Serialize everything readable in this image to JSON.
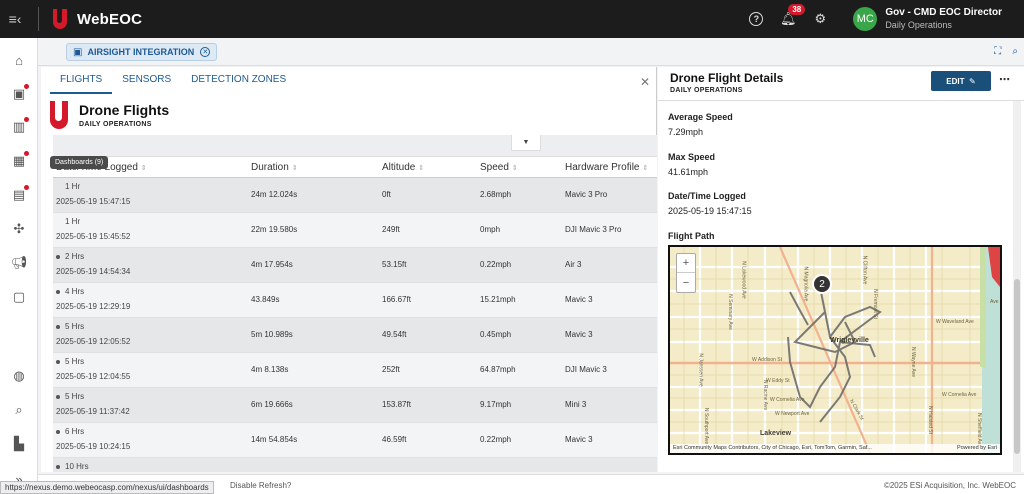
{
  "app": {
    "title": "WebEOC",
    "notifications_count": "38",
    "avatar_initials": "MC",
    "user_name": "Gov - CMD EOC Director",
    "user_sub": "Daily Operations",
    "brand_color": "#d4192b",
    "accent_color": "#1d5a95"
  },
  "nav": {
    "tooltip": "Dashboards (9)",
    "icons": [
      "home-icon",
      "layout-icon",
      "map-icon",
      "dashboards-icon",
      "chat-icon",
      "puzzle-icon",
      "megaphone-icon",
      "contact-icon",
      "globe-icon",
      "search-chart-icon",
      "building-icon",
      "expand-icon"
    ]
  },
  "doc_tab": {
    "label": "AIRSIGHT INTEGRATION"
  },
  "main": {
    "tabs": [
      "FLIGHTS",
      "SENSORS",
      "DETECTION ZONES"
    ],
    "board_title": "Drone Flights",
    "board_sub": "DAILY OPERATIONS",
    "columns": [
      "Date/Time Logged",
      "Duration",
      "Altitude",
      "Speed",
      "Hardware Profile"
    ],
    "rows": [
      {
        "age": "1 Hr",
        "dot": false,
        "date": "2025-05-19 15:47:15",
        "duration": "24m 12.024s",
        "altitude": "0ft",
        "speed": "2.68mph",
        "hardware": "Mavic 3 Pro"
      },
      {
        "age": "1 Hr",
        "dot": false,
        "date": "2025-05-19 15:45:52",
        "duration": "22m 19.580s",
        "altitude": "249ft",
        "speed": "0mph",
        "hardware": "DJI Mavic 3 Pro"
      },
      {
        "age": "2 Hrs",
        "dot": true,
        "date": "2025-05-19 14:54:34",
        "duration": "4m 17.954s",
        "altitude": "53.15ft",
        "speed": "0.22mph",
        "hardware": "Air 3"
      },
      {
        "age": "4 Hrs",
        "dot": true,
        "date": "2025-05-19 12:29:19",
        "duration": "43.849s",
        "altitude": "166.67ft",
        "speed": "15.21mph",
        "hardware": "Mavic 3"
      },
      {
        "age": "5 Hrs",
        "dot": true,
        "date": "2025-05-19 12:05:52",
        "duration": "5m 10.989s",
        "altitude": "49.54ft",
        "speed": "0.45mph",
        "hardware": "Mavic 3"
      },
      {
        "age": "5 Hrs",
        "dot": true,
        "date": "2025-05-19 12:04:55",
        "duration": "4m 8.138s",
        "altitude": "252ft",
        "speed": "64.87mph",
        "hardware": "DJI Mavic 3"
      },
      {
        "age": "5 Hrs",
        "dot": true,
        "date": "2025-05-19 11:37:42",
        "duration": "6m 19.666s",
        "altitude": "153.87ft",
        "speed": "9.17mph",
        "hardware": "Mini 3"
      },
      {
        "age": "6 Hrs",
        "dot": true,
        "date": "2025-05-19 10:24:15",
        "duration": "14m 54.854s",
        "altitude": "46.59ft",
        "speed": "0.22mph",
        "hardware": "Mavic 3"
      },
      {
        "age": "10 Hrs",
        "dot": true,
        "date": "",
        "duration": "",
        "altitude": "",
        "speed": "",
        "hardware": ""
      }
    ]
  },
  "detail": {
    "title": "Drone Flight Details",
    "sub": "DAILY OPERATIONS",
    "edit_label": "EDIT",
    "fields": [
      {
        "label": "Average Speed",
        "value": "7.29mph"
      },
      {
        "label": "Max Speed",
        "value": "41.61mph"
      },
      {
        "label": "Date/Time Logged",
        "value": "2025-05-19 15:47:15"
      }
    ],
    "flight_path_label": "Flight Path",
    "map": {
      "marker": "2",
      "city_label": "Lakeview",
      "wrigleyville": "Wrigleyville",
      "streets": [
        "W Addison St",
        "N Magnolia Ave",
        "N Racine Ave",
        "N Clark St",
        "W Cornelia Ave",
        "W Eddy St",
        "W Newport Ave",
        "N Fremont St",
        "W Waveland Ave",
        "N Seminary Ave",
        "N Lakewood Ave",
        "N Wayne Ave",
        "N Halsted St",
        "N Southport Ave",
        "N Janssen Ave",
        "W Cornelia Ave",
        "N Sheffield Ave",
        "N Clifton Ave",
        "Ave"
      ],
      "attribution": "Esri Community Maps Contributors, City of Chicago, Esri, TomTom, Garmin, Saf...",
      "powered_by": "Powered by Esri"
    }
  },
  "footer": {
    "disable_refresh": "Disable Refresh?",
    "copyright": "©2025 ESi Acquisition, Inc. WebEOC",
    "status_url": "https://nexus.demo.webeocasp.com/nexus/ui/dashboards"
  }
}
